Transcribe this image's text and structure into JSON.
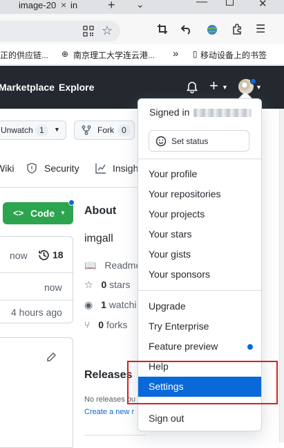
{
  "browser": {
    "tab_title": "image-20",
    "tab_close": "×",
    "tab2_fragment": "in",
    "new_tab": "+",
    "tab_list": "⌄",
    "bookmarks": [
      {
        "label": "正的供应链..."
      },
      {
        "label": "南京理工大学连云港..."
      },
      {
        "label": "»"
      },
      {
        "label": "移动设备上的书签"
      }
    ]
  },
  "header": {
    "nav": [
      "Marketplace",
      "Explore"
    ],
    "plus": "+"
  },
  "repo_actions": {
    "watch_label": "Unwatch",
    "watch_count": "1",
    "fork_label": "Fork",
    "fork_count": "0"
  },
  "repo_nav": {
    "wiki": "Wiki",
    "security": "Security",
    "insights": "Insigh"
  },
  "code_button": {
    "label": "Code"
  },
  "file_box": {
    "row1_time": "now",
    "commit_count": "18",
    "row2_time": "now",
    "row3_time": "4 hours ago"
  },
  "about": {
    "heading": "About",
    "repo_name": "imgall",
    "readme": "Readme",
    "stars": "0",
    "stars_label": "stars",
    "watching": "1",
    "watching_label": "watchi",
    "forks": "0",
    "forks_label": "forks"
  },
  "releases": {
    "heading": "Releases",
    "none_text": "No releases pu",
    "create_link": "Create a new r"
  },
  "dropdown": {
    "signed_in_label": "Signed in",
    "set_status": "Set status",
    "items_group1": [
      "Your profile",
      "Your repositories",
      "Your projects",
      "Your stars",
      "Your gists",
      "Your sponsors"
    ],
    "items_group2": [
      "Upgrade",
      "Try Enterprise",
      "Feature preview",
      "Help",
      "Settings"
    ],
    "sign_out": "Sign out",
    "active_item": "Settings"
  },
  "colors": {
    "accent": "#0969da",
    "header_bg": "#24292f",
    "code_green": "#2da44e",
    "highlight_red": "#d91e1e"
  }
}
